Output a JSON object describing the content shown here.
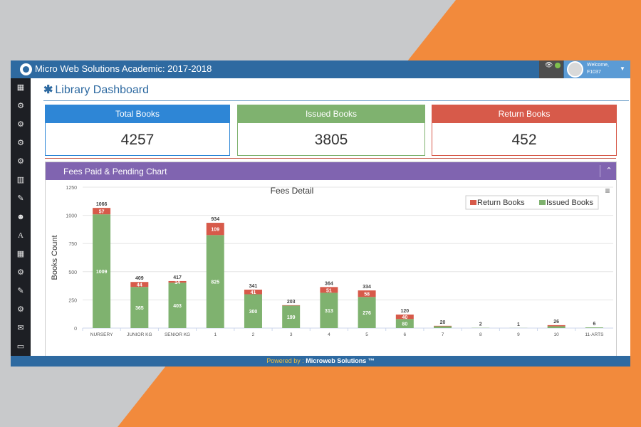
{
  "app": {
    "title": "Micro Web Solutions Academic: 2017-2018",
    "welcome": "Welcome,",
    "user": "F1037"
  },
  "page": {
    "title": "Library Dashboard"
  },
  "stats": [
    {
      "label": "Total Books",
      "value": "4257",
      "color": "#2e86d6"
    },
    {
      "label": "Issued Books",
      "value": "3805",
      "color": "#7fb26f"
    },
    {
      "label": "Return Books",
      "value": "452",
      "color": "#d75a4a"
    }
  ],
  "panel": {
    "title": "Fees Paid & Pending Chart"
  },
  "sidebar": {
    "icons": [
      "table-icon",
      "gears-icon",
      "gears-icon",
      "gears-icon",
      "gears-icon",
      "calendar-icon",
      "edit-icon",
      "users-icon",
      "font-icon",
      "table-icon",
      "gears-icon",
      "edit-icon",
      "gears-icon",
      "envelope-icon",
      "card-icon"
    ]
  },
  "footer": {
    "powered": "Powered by :",
    "brand": "Microweb Solutions ™"
  },
  "chart_data": {
    "type": "bar",
    "stacked": true,
    "title": "Fees Detail",
    "ylabel": "Books Count",
    "ylim": [
      0,
      1250
    ],
    "yticks": [
      0,
      250,
      500,
      750,
      1000,
      1250
    ],
    "categories": [
      "NURSERY",
      "JUNIOR KG",
      "SENIOR KG",
      "1",
      "2",
      "3",
      "4",
      "5",
      "6",
      "7",
      "8",
      "9",
      "10",
      "11-ARTS"
    ],
    "series": [
      {
        "name": "Issued Books",
        "color": "#7fb26f",
        "values": [
          1009,
          365,
          403,
          825,
          300,
          199,
          313,
          276,
          80,
          16,
          2,
          1,
          16,
          6
        ]
      },
      {
        "name": "Return Books",
        "color": "#d75a4a",
        "values": [
          57,
          44,
          14,
          109,
          41,
          4,
          51,
          58,
          40,
          4,
          0,
          0,
          10,
          0
        ]
      }
    ],
    "totals": [
      1066,
      409,
      417,
      934,
      341,
      203,
      364,
      334,
      120,
      20,
      2,
      1,
      26,
      6
    ],
    "legend": "top-right",
    "grid": true
  }
}
